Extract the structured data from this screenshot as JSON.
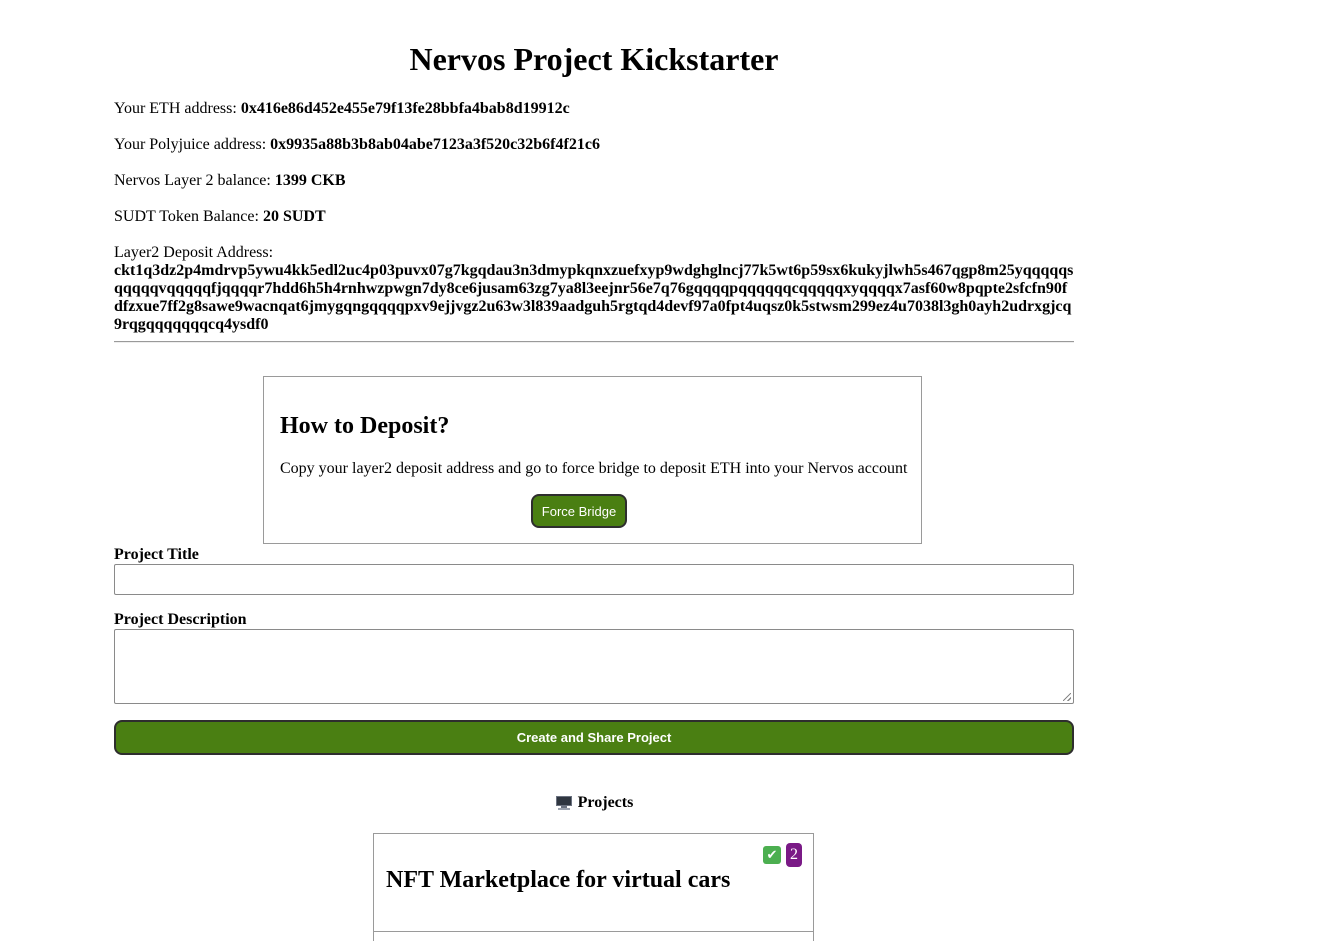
{
  "page": {
    "title": "Nervos Project Kickstarter"
  },
  "account": {
    "eth_label": "Your ETH address:",
    "eth_address": "0x416e86d452e455e79f13fe28bbfa4bab8d19912c",
    "polyjuice_label": "Your Polyjuice address:",
    "polyjuice_address": "0x9935a88b3b8ab04abe7123a3f520c32b6f4f21c6",
    "l2_balance_label": "Nervos Layer 2 balance:",
    "l2_balance_value": "1399 CKB",
    "sudt_label": "SUDT Token Balance:",
    "sudt_value": "20 SUDT",
    "deposit_label": "Layer2 Deposit Address:",
    "deposit_address": "ckt1q3dz2p4mdrvp5ywu4kk5edl2uc4p03puvx07g7kgqdau3n3dmypkqnxzuefxyp9wdghglncj77k5wt6p59sx6kukyjlwh5s467qgp8m25yqqqqqsqqqqqvqqqqqfjqqqqr7hdd6h5h4rnhwzpwgn7dy8ce6jusam63zg7ya8l3eejnr56e7q76gqqqqpqqqqqqcqqqqqxyqqqqx7asf60w8pqpte2sfcfn90fdfzxue7ff2g8sawe9wacnqat6jmygqngqqqqpxv9ejjvgz2u63w3l839aadguh5rgtqd4devf97a0fpt4uqsz0k5stwsm299ez4u7038l3gh0ayh2udrxgjcq9rqgqqqqqqqcq4ysdf0"
  },
  "howto": {
    "title": "How to Deposit?",
    "text": "Copy your layer2 deposit address and go to force bridge to deposit ETH into your Nervos account",
    "button_label": "Force Bridge"
  },
  "form": {
    "title_label": "Project Title",
    "title_value": "",
    "description_label": "Project Description",
    "description_value": "",
    "submit_label": "Create and Share Project"
  },
  "projects": {
    "heading": "Projects",
    "heading_icon": "desktop-computer-icon",
    "items": [
      {
        "title": "NFT Marketplace for virtual cars",
        "status_icon": "check-mark-icon",
        "count": "2"
      }
    ]
  },
  "colors": {
    "button_green": "#4a7f12",
    "badge_purple": "#7a1a86",
    "check_green": "#4caf50"
  }
}
